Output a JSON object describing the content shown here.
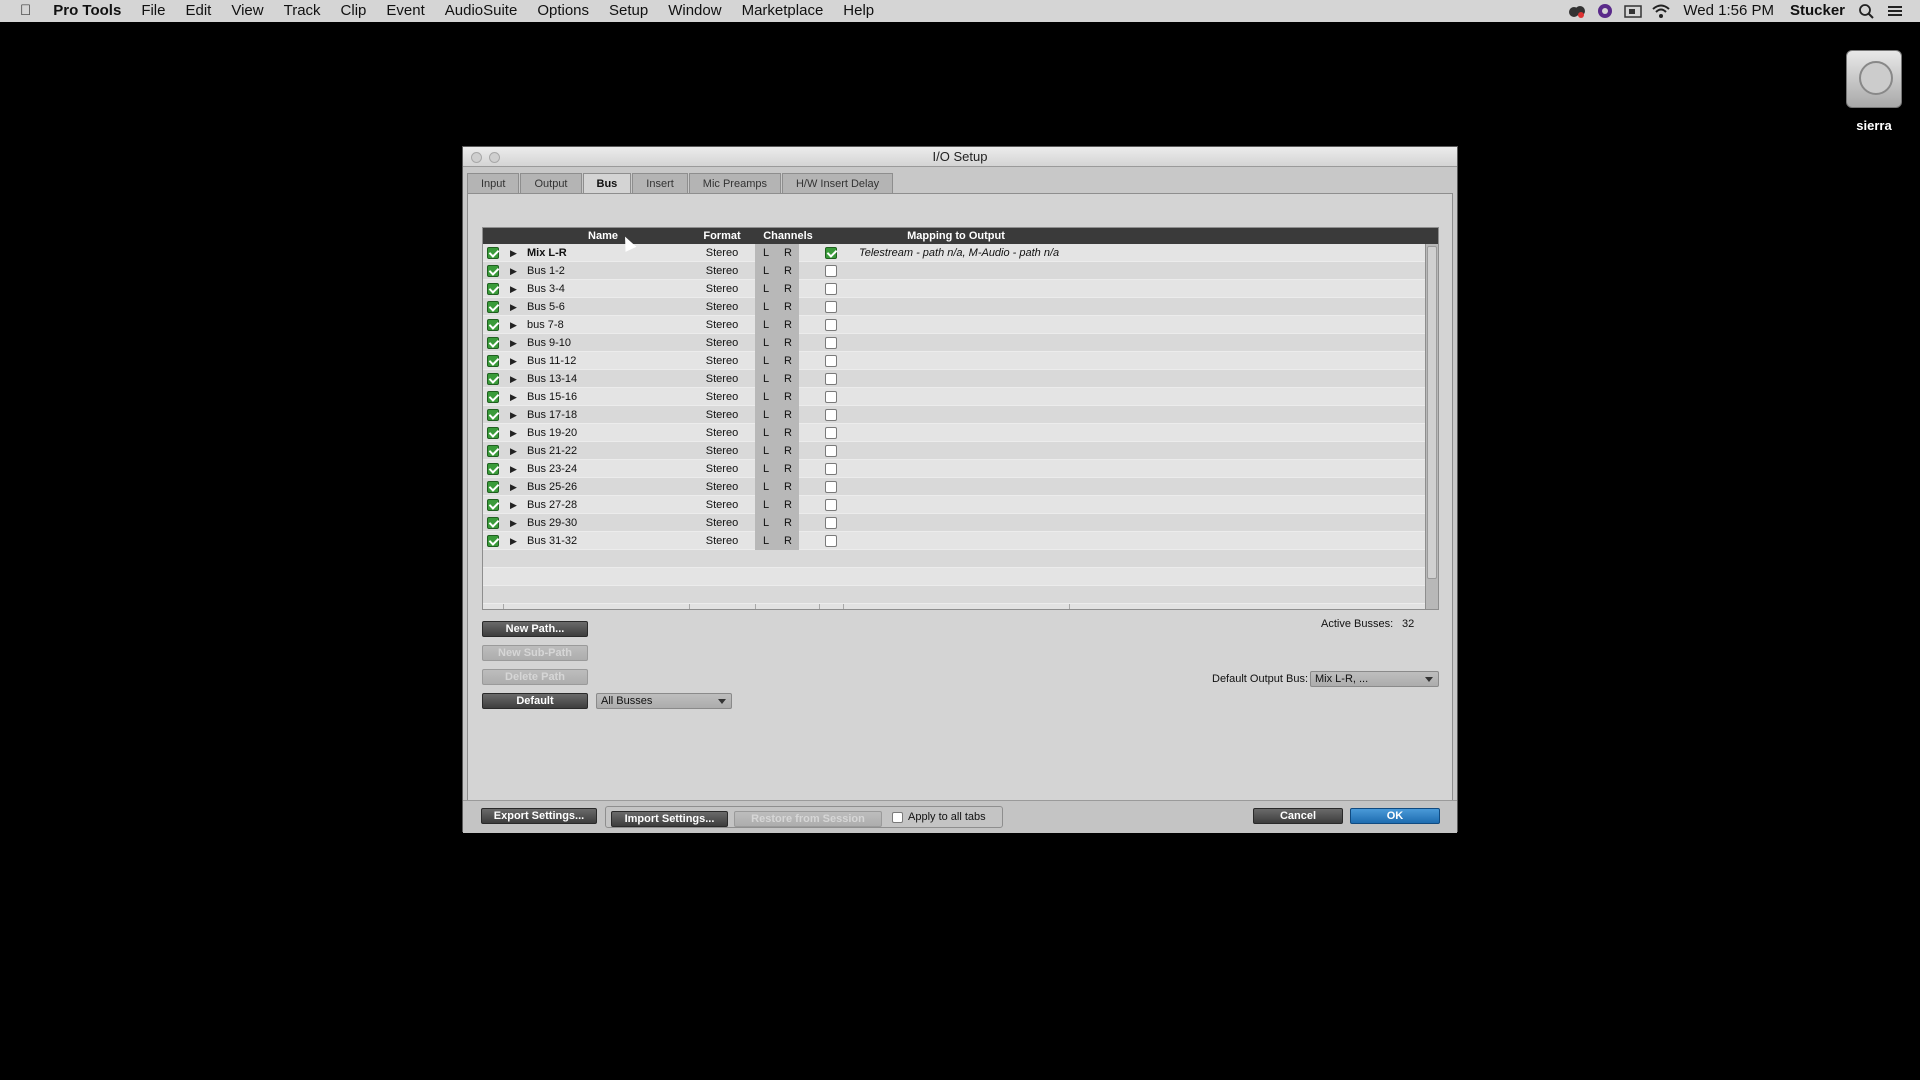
{
  "menubar": {
    "app_name": "Pro Tools",
    "items": [
      "File",
      "Edit",
      "View",
      "Track",
      "Clip",
      "Event",
      "AudioSuite",
      "Options",
      "Setup",
      "Window",
      "Marketplace",
      "Help"
    ],
    "clock": "Wed 1:56 PM",
    "user": "Stucker"
  },
  "desktop": {
    "disk_label": "sierra"
  },
  "dialog": {
    "title": "I/O Setup",
    "tabs": [
      "Input",
      "Output",
      "Bus",
      "Insert",
      "Mic Preamps",
      "H/W Insert Delay"
    ],
    "active_tab": "Bus",
    "columns": {
      "name": "Name",
      "format": "Format",
      "channels": "Channels",
      "mapping": "Mapping to Output"
    },
    "rows": [
      {
        "name": "Mix L-R",
        "format": "Stereo",
        "l": "L",
        "r": "R",
        "mapped": true,
        "mapping": "Telestream - path n/a, M-Audio - path n/a"
      },
      {
        "name": "Bus 1-2",
        "format": "Stereo",
        "l": "L",
        "r": "R",
        "mapped": false,
        "mapping": ""
      },
      {
        "name": "Bus 3-4",
        "format": "Stereo",
        "l": "L",
        "r": "R",
        "mapped": false,
        "mapping": ""
      },
      {
        "name": "Bus 5-6",
        "format": "Stereo",
        "l": "L",
        "r": "R",
        "mapped": false,
        "mapping": ""
      },
      {
        "name": "bus 7-8",
        "format": "Stereo",
        "l": "L",
        "r": "R",
        "mapped": false,
        "mapping": ""
      },
      {
        "name": "Bus 9-10",
        "format": "Stereo",
        "l": "L",
        "r": "R",
        "mapped": false,
        "mapping": ""
      },
      {
        "name": "Bus 11-12",
        "format": "Stereo",
        "l": "L",
        "r": "R",
        "mapped": false,
        "mapping": ""
      },
      {
        "name": "Bus 13-14",
        "format": "Stereo",
        "l": "L",
        "r": "R",
        "mapped": false,
        "mapping": ""
      },
      {
        "name": "Bus 15-16",
        "format": "Stereo",
        "l": "L",
        "r": "R",
        "mapped": false,
        "mapping": ""
      },
      {
        "name": "Bus 17-18",
        "format": "Stereo",
        "l": "L",
        "r": "R",
        "mapped": false,
        "mapping": ""
      },
      {
        "name": "Bus 19-20",
        "format": "Stereo",
        "l": "L",
        "r": "R",
        "mapped": false,
        "mapping": ""
      },
      {
        "name": "Bus 21-22",
        "format": "Stereo",
        "l": "L",
        "r": "R",
        "mapped": false,
        "mapping": ""
      },
      {
        "name": "Bus 23-24",
        "format": "Stereo",
        "l": "L",
        "r": "R",
        "mapped": false,
        "mapping": ""
      },
      {
        "name": "Bus 25-26",
        "format": "Stereo",
        "l": "L",
        "r": "R",
        "mapped": false,
        "mapping": ""
      },
      {
        "name": "Bus 27-28",
        "format": "Stereo",
        "l": "L",
        "r": "R",
        "mapped": false,
        "mapping": ""
      },
      {
        "name": "Bus 29-30",
        "format": "Stereo",
        "l": "L",
        "r": "R",
        "mapped": false,
        "mapping": ""
      },
      {
        "name": "Bus 31-32",
        "format": "Stereo",
        "l": "L",
        "r": "R",
        "mapped": false,
        "mapping": ""
      }
    ],
    "buttons": {
      "new_path": "New Path...",
      "new_sub_path": "New Sub-Path",
      "delete_path": "Delete Path",
      "default": "Default",
      "export": "Export Settings...",
      "import": "Import Settings...",
      "restore": "Restore from Session",
      "cancel": "Cancel",
      "ok": "OK"
    },
    "filter_select": "All Busses",
    "active_busses_label": "Active Busses:",
    "active_busses_value": "32",
    "default_output_label": "Default Output Bus:",
    "default_output_value": "Mix L-R, ...",
    "apply_all_tabs": "Apply to all tabs"
  }
}
